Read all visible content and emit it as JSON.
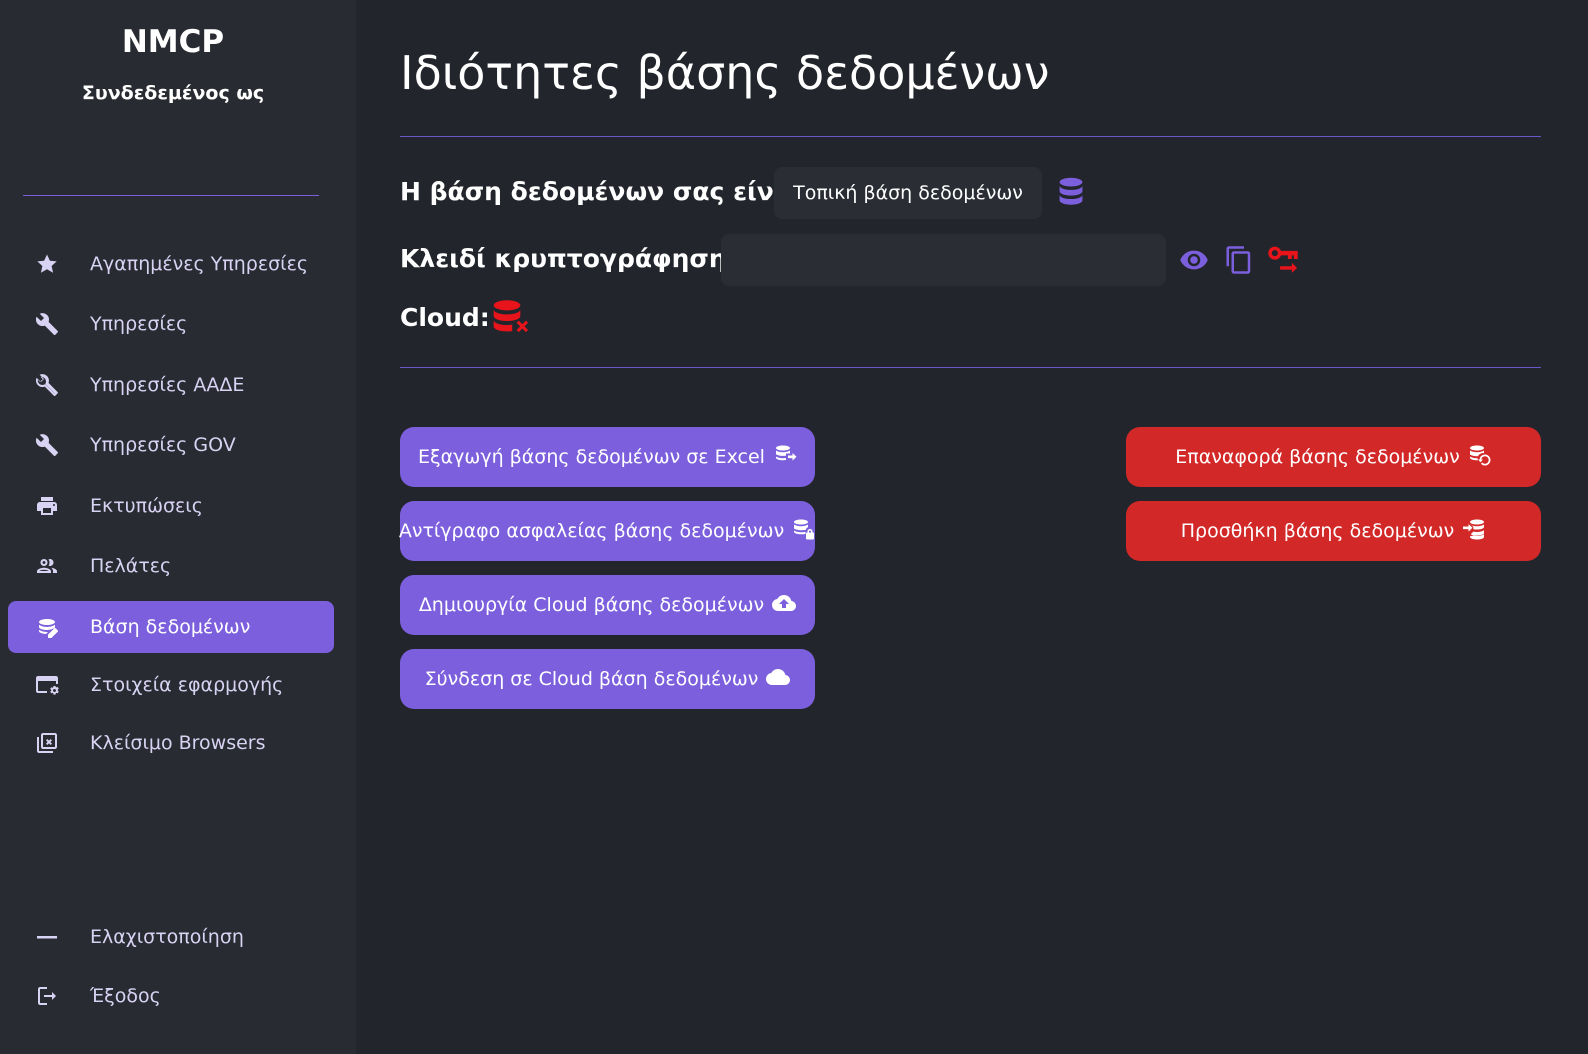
{
  "sidebar": {
    "brand": "NMCP",
    "logged_in_as": "Συνδεδεμένος ως",
    "items": [
      {
        "label": "Αγαπημένες Υπηρεσίες",
        "icon": "star-icon"
      },
      {
        "label": "Υπηρεσίες",
        "icon": "wrench-icon"
      },
      {
        "label": "Υπηρεσίες ΑΑΔΕ",
        "icon": "wrench-outline-icon"
      },
      {
        "label": "Υπηρεσίες GOV",
        "icon": "wrench-icon"
      },
      {
        "label": "Εκτυπώσεις",
        "icon": "printer-icon"
      },
      {
        "label": "Πελάτες",
        "icon": "people-icon"
      },
      {
        "label": "Βάση δεδομένων",
        "icon": "database-edit-icon",
        "active": true
      },
      {
        "label": "Στοιχεία εφαρμογής",
        "icon": "app-settings-icon"
      },
      {
        "label": "Κλείσιμο Browsers",
        "icon": "close-browsers-icon"
      }
    ],
    "bottom_items": [
      {
        "label": "Ελαχιστοποίηση",
        "icon": "minimize-icon"
      },
      {
        "label": "Έξοδος",
        "icon": "logout-icon"
      }
    ]
  },
  "main": {
    "title": "Ιδιότητες βάσης δεδομένων",
    "db_label": "Η βάση δεδομένων σας είναι:",
    "db_value": "Τοπική βάση δεδομένων",
    "key_label": "Κλειδί κρυπτογράφησης:",
    "key_value": "",
    "cloud_label": "Cloud:",
    "left_buttons": [
      {
        "label": "Εξαγωγή βάσης δεδομένων σε Excel",
        "icon": "database-export-icon"
      },
      {
        "label": "Αντίγραφο ασφαλείας βάσης δεδομένων",
        "icon": "database-lock-icon"
      },
      {
        "label": "Δημιουργία Cloud βάσης δεδομένων",
        "icon": "cloud-upload-icon"
      },
      {
        "label": "Σύνδεση σε Cloud βάση δεδομένων",
        "icon": "cloud-icon"
      }
    ],
    "right_buttons": [
      {
        "label": "Επαναφορά βάσης δεδομένων",
        "icon": "database-restore-icon"
      },
      {
        "label": "Προσθήκη βάσης δεδομένων",
        "icon": "database-import-icon"
      }
    ]
  },
  "colors": {
    "accent": "#7b5fdc",
    "danger": "#d32828",
    "error_icon": "#e8141b",
    "background": "#22252b",
    "sidebar": "#282b31"
  }
}
